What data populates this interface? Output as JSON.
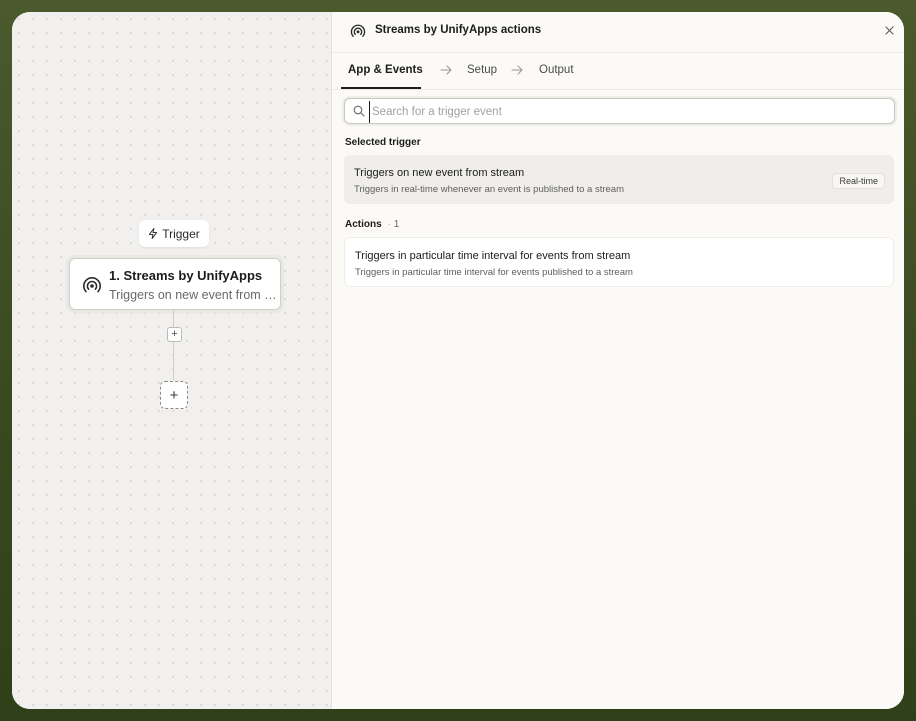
{
  "canvas": {
    "trigger_label": "Trigger",
    "node": {
      "title": "1. Streams by UnifyApps",
      "subtitle": "Triggers on new event from stream"
    },
    "add_step_small": "+",
    "add_step_big": "+"
  },
  "panel": {
    "title": "Streams by UnifyApps actions",
    "tabs": [
      {
        "label": "App & Events",
        "active": true
      },
      {
        "label": "Setup",
        "active": false
      },
      {
        "label": "Output",
        "active": false
      }
    ],
    "search": {
      "value": "",
      "placeholder": "Search for a trigger event"
    },
    "selected_trigger": {
      "heading": "Selected trigger",
      "title": "Triggers on new event from stream",
      "description": "Triggers in real-time whenever an event is published to a stream",
      "badge": "Real-time"
    },
    "actions": {
      "heading": "Actions",
      "count": "1",
      "items": [
        {
          "title": "Triggers in particular time interval for events from stream",
          "description": "Triggers in particular time interval for events published to a stream"
        }
      ]
    }
  },
  "icons": {
    "app": "stream-broadcast-icon",
    "trigger": "lightning-bolt-icon",
    "close": "close-icon",
    "search": "search-icon",
    "tab_separator": "arrow-right-icon"
  }
}
